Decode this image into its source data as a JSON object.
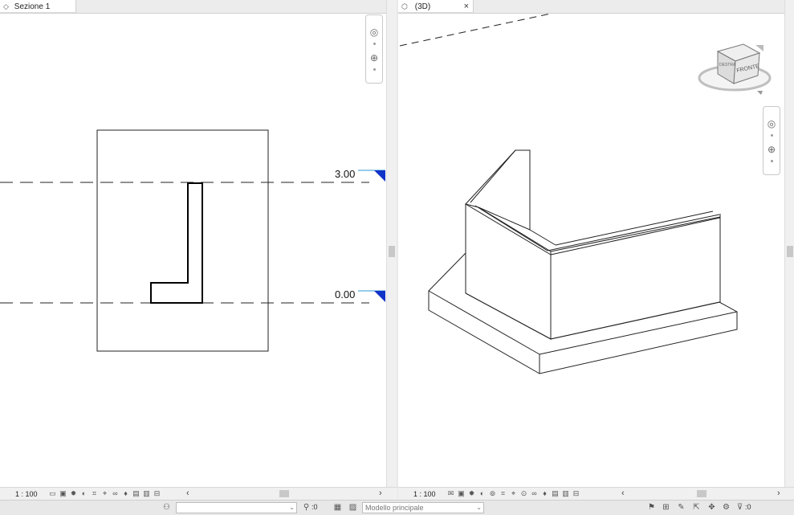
{
  "left_view": {
    "tab_title": "Sezione 1",
    "scale": "1 : 100",
    "levels": [
      {
        "label": "3.00"
      },
      {
        "label": "0.00"
      }
    ]
  },
  "right_view": {
    "tab_title": "(3D)",
    "tab_close": "×",
    "scale": "1 : 100",
    "viewcube": {
      "front_label": "FRONTE",
      "side_label": "DESTRA"
    }
  },
  "statusbar": {
    "selection_count": ":0",
    "filter_count": ":0",
    "model": "Modello principale"
  },
  "colors": {
    "level_marker": "#1033c8",
    "level_line": "#2f9ad8",
    "tab_active_bg": "#ffffff",
    "chrome_bg": "#e8e8e8"
  },
  "icons": {
    "left_tab_icon": "section-view-icon",
    "right_tab_icon": "3d-view-icon"
  }
}
